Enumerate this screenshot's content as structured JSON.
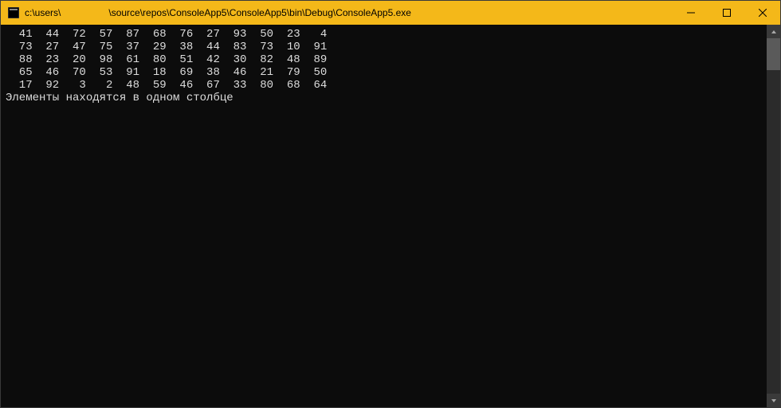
{
  "window": {
    "title_prefix": "c:\\users\\",
    "title_suffix": "\\source\\repos\\ConsoleApp5\\ConsoleApp5\\bin\\Debug\\ConsoleApp5.exe"
  },
  "console": {
    "matrix": [
      [
        41,
        44,
        72,
        57,
        87,
        68,
        76,
        27,
        93,
        50,
        23,
        4
      ],
      [
        73,
        27,
        47,
        75,
        37,
        29,
        38,
        44,
        83,
        73,
        10,
        91
      ],
      [
        88,
        23,
        20,
        98,
        61,
        80,
        51,
        42,
        30,
        82,
        48,
        89
      ],
      [
        65,
        46,
        70,
        53,
        91,
        18,
        69,
        38,
        46,
        21,
        79,
        50
      ],
      [
        17,
        92,
        3,
        2,
        48,
        59,
        46,
        67,
        33,
        80,
        68,
        64
      ]
    ],
    "message": "Элементы находятся в одном столбце"
  },
  "colors": {
    "titlebar_bg": "#f4b819",
    "console_bg": "#0c0c0c",
    "console_fg": "#dcdcdc"
  }
}
